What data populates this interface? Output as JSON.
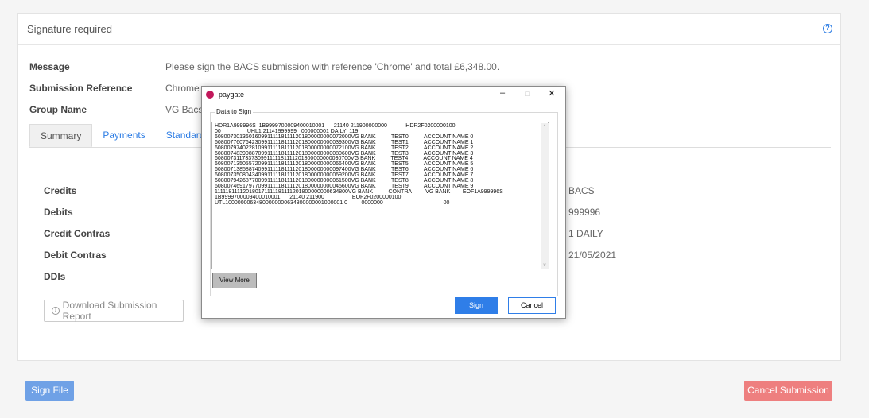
{
  "panel": {
    "title": "Signature required"
  },
  "info": [
    {
      "label": "Message",
      "value": "Please sign the BACS submission with reference 'Chrome' and total £6,348.00."
    },
    {
      "label": "Submission Reference",
      "value": "Chrome"
    },
    {
      "label": "Group Name",
      "value": "VG Bacs"
    }
  ],
  "tabs": [
    {
      "label": "Summary"
    },
    {
      "label": "Payments"
    },
    {
      "label": "Standard18"
    }
  ],
  "summary": {
    "labels": [
      "Credits",
      "Debits",
      "Credit Contras",
      "Debit Contras",
      "DDIs"
    ],
    "values": [
      "BACS",
      "999996",
      "1 DAILY",
      "21/05/2021"
    ]
  },
  "buttons": {
    "download": "Download Submission Report",
    "sign_file": "Sign File",
    "cancel_submission": "Cancel Submission"
  },
  "dialog": {
    "title": "paygate",
    "minimize": "–",
    "maximize": "□",
    "close": "✕",
    "group_label": "Data to Sign",
    "data_text": "HDR1A999996S  1B9999700009400010001      21140 211900000000            HDR2F0200000100\n00                 UHL1 21141999999   000000001 DAILY  119\n608007301360160991111181111201800000000072000VG BANK          TEST0          ACCOUNT NAME 0\n608007760764230991111181111201800000000039300VG BANK          TEST1          ACCOUNT NAME 1\n608007974022810991111181111201800000000072100VG BANK          TEST2          ACCOUNT NAME 2\n608007483908870991111181111201800000000080600VG BANK          TEST3          ACCOUNT NAME 3\n608007311733730991111181111201800000000030700VG BANK          TEST4          ACCOUNT NAME 4\n608007135055720991111181111201800000000066400VG BANK          TEST5          ACCOUNT NAME 5\n608007138588740991111181111201800000000097400VG BANK          TEST6          ACCOUNT NAME 6\n608007350804340991111181111201800000000069200VG BANK          TEST7          ACCOUNT NAME 7\n608007942687700991111181111201800000000061500VG BANK          TEST8          ACCOUNT NAME 8\n608007469179770991111181111201800000000045600VG BANK          TEST9          ACCOUNT NAME 9\n111118111120180171111181111201800000000634800VG BANK          CONTRA         VG BANK        EOF1A999996S\n1B9999700009400010001      21140 211900                  EOF2F0200000100\nUTL10000000634800000000634800000001000001 0         0000000                                       00",
    "view_more": "View More",
    "sign": "Sign",
    "cancel": "Cancel"
  },
  "colors": {
    "accent": "#2a7be4",
    "sign_file_bg": "#6fa1e6",
    "cancel_bg": "#ee7f7f",
    "dialog_sign_bg": "#2f7ee8",
    "paygate_logo": "#c2185b"
  }
}
